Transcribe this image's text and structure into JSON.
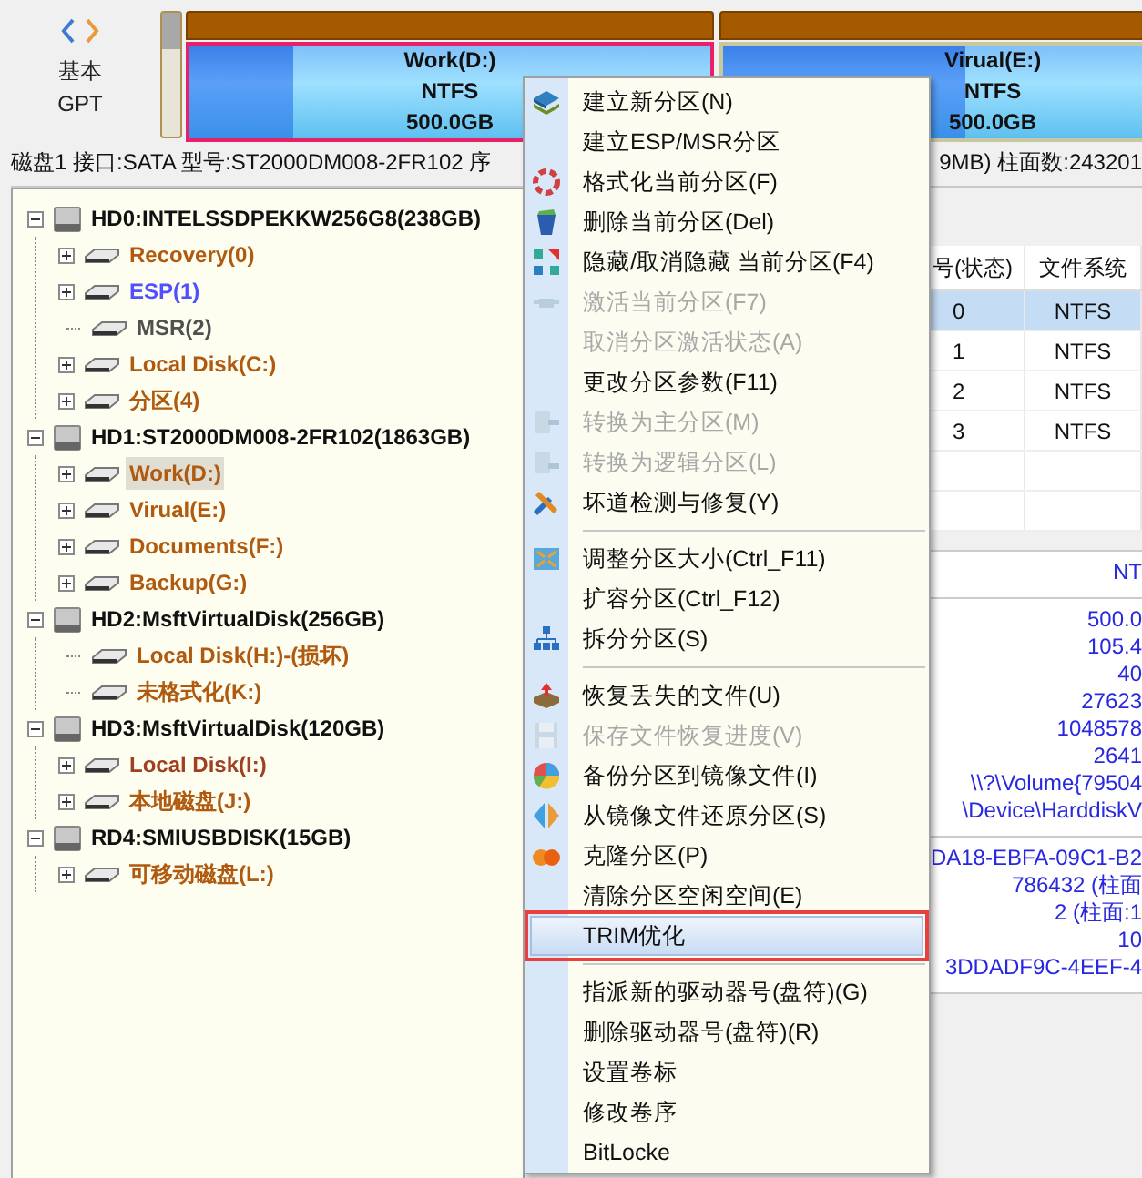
{
  "disk_header": {
    "type_line1": "基本",
    "type_line2": "GPT"
  },
  "partitions": [
    {
      "name": "Work(D:)",
      "fs": "NTFS",
      "size": "500.0GB",
      "selected": true,
      "level": 0.2
    },
    {
      "name": "Virual(E:)",
      "fs": "NTFS",
      "size": "500.0GB",
      "selected": false,
      "level": 0.45
    }
  ],
  "status_bar": {
    "left": "磁盘1 接口:SATA  型号:ST2000DM008-2FR102  序",
    "right": "9MB)  柱面数:243201"
  },
  "tree": [
    {
      "label": "HD0:INTELSSDPEKKW256G8(238GB)",
      "expanded": true,
      "children": [
        {
          "label": "Recovery(0)",
          "color": "#b05a10",
          "expandable": true,
          "selected": false
        },
        {
          "label": "ESP(1)",
          "color": "#5050ff",
          "expandable": true,
          "selected": false
        },
        {
          "label": "MSR(2)",
          "color": "#505050",
          "expandable": false,
          "selected": false
        },
        {
          "label": "Local Disk(C:)",
          "color": "#b05a10",
          "expandable": true,
          "selected": false
        },
        {
          "label": "分区(4)",
          "color": "#b05a10",
          "expandable": true,
          "selected": false
        }
      ]
    },
    {
      "label": "HD1:ST2000DM008-2FR102(1863GB)",
      "expanded": true,
      "children": [
        {
          "label": "Work(D:)",
          "color": "#b05a10",
          "expandable": true,
          "selected": true
        },
        {
          "label": "Virual(E:)",
          "color": "#b05a10",
          "expandable": true,
          "selected": false
        },
        {
          "label": "Documents(F:)",
          "color": "#b05a10",
          "expandable": true,
          "selected": false
        },
        {
          "label": "Backup(G:)",
          "color": "#b05a10",
          "expandable": true,
          "selected": false
        }
      ]
    },
    {
      "label": "HD2:MsftVirtualDisk(256GB)",
      "expanded": true,
      "children": [
        {
          "label": "Local Disk(H:)-(损坏)",
          "color": "#b05a10",
          "expandable": false,
          "selected": false
        },
        {
          "label": "未格式化(K:)",
          "color": "#b05a10",
          "expandable": false,
          "selected": false
        }
      ]
    },
    {
      "label": "HD3:MsftVirtualDisk(120GB)",
      "expanded": true,
      "children": [
        {
          "label": "Local Disk(I:)",
          "color": "#a04020",
          "expandable": true,
          "selected": false
        },
        {
          "label": "本地磁盘(J:)",
          "color": "#b05a10",
          "expandable": true,
          "selected": false
        }
      ]
    },
    {
      "label": "RD4:SMIUSBDISK(15GB)",
      "expanded": true,
      "children": [
        {
          "label": "可移动磁盘(L:)",
          "color": "#b05a10",
          "expandable": true,
          "selected": false
        }
      ]
    }
  ],
  "table": {
    "columns": [
      "号(状态)",
      "文件系统"
    ],
    "rows": [
      {
        "cells": [
          "0",
          "NTFS"
        ],
        "selected": true
      },
      {
        "cells": [
          "1",
          "NTFS"
        ],
        "selected": false
      },
      {
        "cells": [
          "2",
          "NTFS"
        ],
        "selected": false
      },
      {
        "cells": [
          "3",
          "NTFS"
        ],
        "selected": false
      }
    ]
  },
  "info_panel": {
    "groups": [
      [
        "NT"
      ],
      [
        "500.0",
        "105.4",
        "40",
        "27623",
        "1048578",
        "2641",
        "\\\\?\\Volume{79504",
        "\\Device\\HarddiskV"
      ],
      [
        "DA18-EBFA-09C1-B2",
        "786432 (柱面",
        "2 (柱面:1",
        "10",
        "3DDADF9C-4EEF-4"
      ]
    ]
  },
  "context_menu": [
    {
      "kind": "item",
      "label": "建立新分区(N)",
      "disabled": false,
      "highlighted": false
    },
    {
      "kind": "item",
      "label": "建立ESP/MSR分区",
      "disabled": false,
      "highlighted": false
    },
    {
      "kind": "item",
      "label": "格式化当前分区(F)",
      "disabled": false,
      "highlighted": false
    },
    {
      "kind": "item",
      "label": "删除当前分区(Del)",
      "disabled": false,
      "highlighted": false
    },
    {
      "kind": "item",
      "label": "隐藏/取消隐藏 当前分区(F4)",
      "disabled": false,
      "highlighted": false
    },
    {
      "kind": "item",
      "label": "激活当前分区(F7)",
      "disabled": true,
      "highlighted": false
    },
    {
      "kind": "item",
      "label": "取消分区激活状态(A)",
      "disabled": true,
      "highlighted": false
    },
    {
      "kind": "item",
      "label": "更改分区参数(F11)",
      "disabled": false,
      "highlighted": false
    },
    {
      "kind": "item",
      "label": "转换为主分区(M)",
      "disabled": true,
      "highlighted": false
    },
    {
      "kind": "item",
      "label": "转换为逻辑分区(L)",
      "disabled": true,
      "highlighted": false
    },
    {
      "kind": "item",
      "label": "坏道检测与修复(Y)",
      "disabled": false,
      "highlighted": false
    },
    {
      "kind": "separator"
    },
    {
      "kind": "item",
      "label": "调整分区大小(Ctrl_F11)",
      "disabled": false,
      "highlighted": false
    },
    {
      "kind": "item",
      "label": "扩容分区(Ctrl_F12)",
      "disabled": false,
      "highlighted": false
    },
    {
      "kind": "item",
      "label": "拆分分区(S)",
      "disabled": false,
      "highlighted": false
    },
    {
      "kind": "separator"
    },
    {
      "kind": "item",
      "label": "恢复丢失的文件(U)",
      "disabled": false,
      "highlighted": false
    },
    {
      "kind": "item",
      "label": "保存文件恢复进度(V)",
      "disabled": true,
      "highlighted": false
    },
    {
      "kind": "item",
      "label": "备份分区到镜像文件(I)",
      "disabled": false,
      "highlighted": false
    },
    {
      "kind": "item",
      "label": "从镜像文件还原分区(S)",
      "disabled": false,
      "highlighted": false
    },
    {
      "kind": "item",
      "label": "克隆分区(P)",
      "disabled": false,
      "highlighted": false
    },
    {
      "kind": "item",
      "label": "清除分区空闲空间(E)",
      "disabled": false,
      "highlighted": false
    },
    {
      "kind": "item",
      "label": "TRIM优化",
      "disabled": false,
      "highlighted": true
    },
    {
      "kind": "separator"
    },
    {
      "kind": "item",
      "label": "指派新的驱动器号(盘符)(G)",
      "disabled": false,
      "highlighted": false
    },
    {
      "kind": "item",
      "label": "删除驱动器号(盘符)(R)",
      "disabled": false,
      "highlighted": false
    },
    {
      "kind": "item",
      "label": "设置卷标",
      "disabled": false,
      "highlighted": false
    },
    {
      "kind": "item",
      "label": "修改卷序",
      "disabled": false,
      "highlighted": false
    },
    {
      "kind": "item",
      "label": "BitLocke",
      "disabled": false,
      "highlighted": false
    }
  ]
}
